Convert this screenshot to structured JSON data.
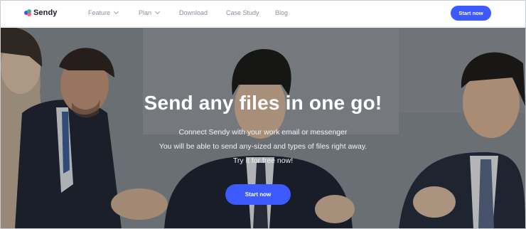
{
  "brand": {
    "name": "Sendy"
  },
  "nav": {
    "items": [
      {
        "label": "Feature",
        "has_dropdown": true
      },
      {
        "label": "Plan",
        "has_dropdown": true
      },
      {
        "label": "Download",
        "has_dropdown": false
      },
      {
        "label": "Case Study",
        "has_dropdown": false
      },
      {
        "label": "Blog",
        "has_dropdown": false
      }
    ],
    "cta_label": "Start now"
  },
  "hero": {
    "title": "Send any files in one go!",
    "subtitle_lines": [
      "Connect Sendy with your work email or messenger",
      "You will be able to send any-sized and types of files right away.",
      "Try it for free now!"
    ],
    "cta_label": "Start now"
  },
  "colors": {
    "accent": "#3d5afe",
    "nav_text": "#8a8f9c",
    "brand_text": "#1c1f2b"
  }
}
